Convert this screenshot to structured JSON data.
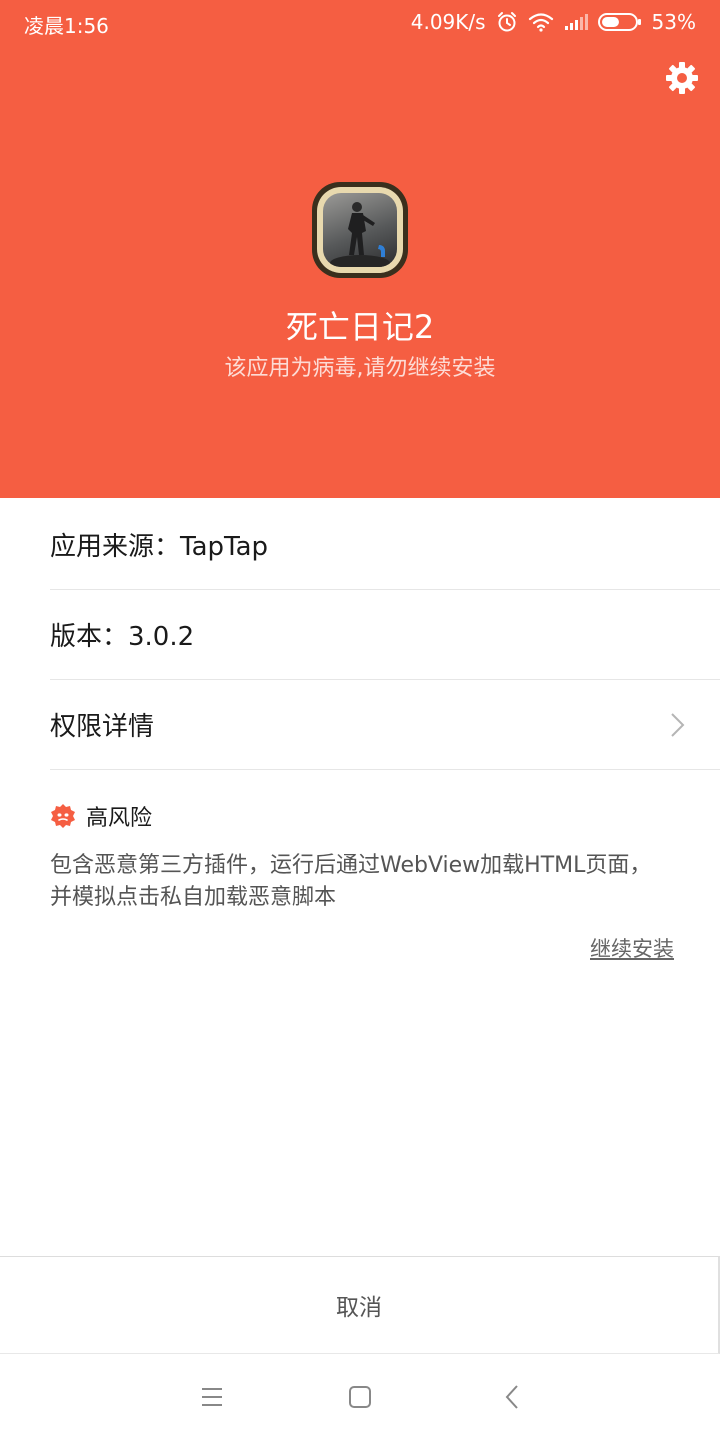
{
  "status_bar": {
    "time": "凌晨1:56",
    "speed": "4.09K/s",
    "battery_percent": "53%",
    "battery_level": 0.53,
    "icons": [
      "alarm-icon",
      "wifi-icon",
      "signal-icon",
      "battery-icon"
    ]
  },
  "header": {
    "background_color": "#f55e42",
    "app_name": "死亡日记2",
    "warning": "该应用为病毒,请勿继续安装",
    "settings_icon": "gear-icon"
  },
  "info": {
    "source": "应用来源：TapTap",
    "version": "版本：3.0.2",
    "permissions_label": "权限详情",
    "chevron_icon": "chevron-right-icon"
  },
  "risk": {
    "level": "高风险",
    "icon": "virus-icon",
    "icon_color": "#f55e42",
    "description": "包含恶意第三方插件，运行后通过WebView加载HTML页面，并模拟点击私自加载恶意脚本",
    "continue_label": "继续安装"
  },
  "footer": {
    "cancel_label": "取消"
  },
  "nav": {
    "buttons": [
      "menu-icon",
      "home-icon",
      "back-icon"
    ]
  }
}
